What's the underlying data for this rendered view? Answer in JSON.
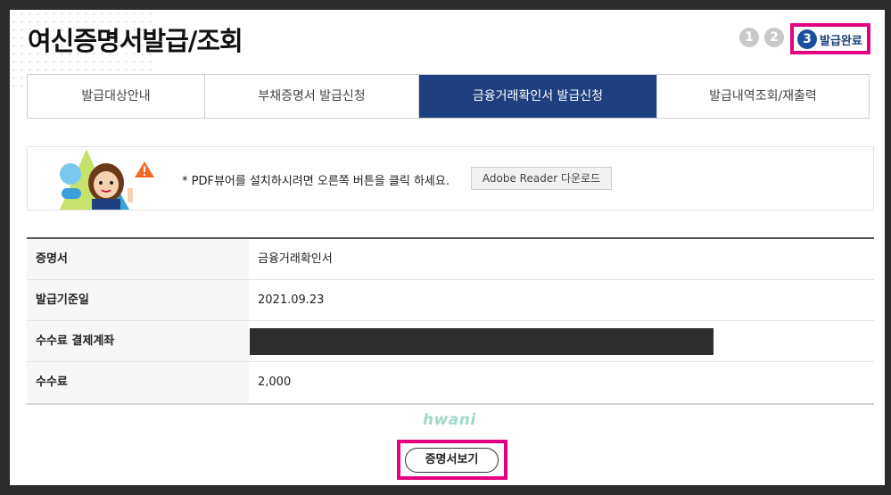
{
  "page": {
    "title": "여신증명서발급/조회"
  },
  "steps": {
    "items": [
      "1",
      "2",
      "3"
    ],
    "active_label": "발급완료"
  },
  "tabs": [
    "발급대상안내",
    "부채증명서 발급신청",
    "금융거래확인서 발급신청",
    "발급내역조회/재출력"
  ],
  "notice": {
    "text": "* PDF뷰어를 설치하시려면 오른쪽 버튼을 클릭 하세요.",
    "button_label": "Adobe Reader 다운로드"
  },
  "info": [
    {
      "label": "증명서",
      "value": "금융거래확인서"
    },
    {
      "label": "발급기준일",
      "value": "2021.09.23"
    },
    {
      "label": "수수료 결제계좌",
      "value": ""
    },
    {
      "label": "수수료",
      "value": "2,000"
    }
  ],
  "watermark": "hwani",
  "actions": {
    "view_certificate": "증명서보기"
  },
  "colors": {
    "accent": "#1e4080",
    "highlight": "#e4007f"
  }
}
